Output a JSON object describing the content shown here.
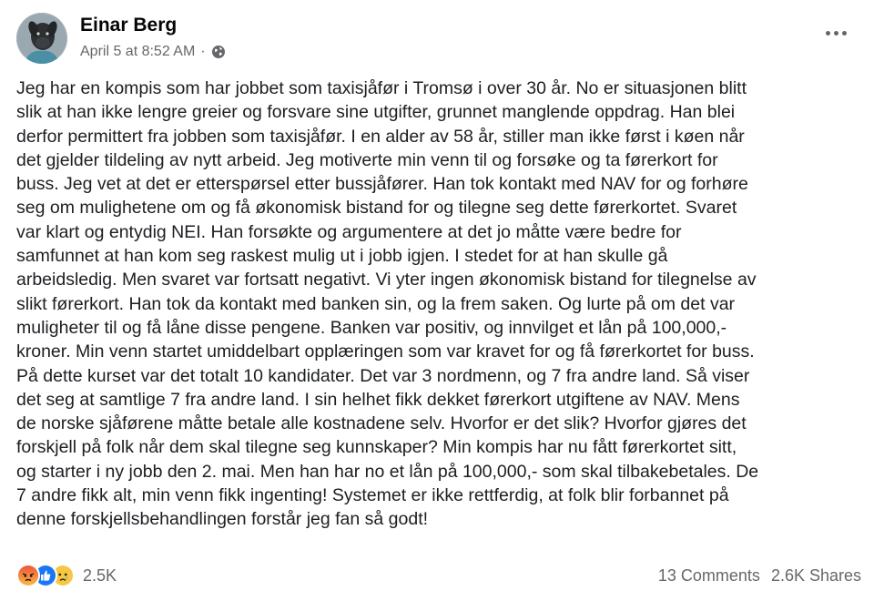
{
  "post": {
    "author": "Einar Berg",
    "timestamp": "April 5 at 8:52 AM",
    "separator": "·",
    "audience_icon": "globe-icon",
    "more_icon": "more-options-icon",
    "body_lines": [
      "Jeg har en kompis som har jobbet som taxisjåfør i Tromsø i over 30 år. No er situasjonen blitt",
      "slik at han ikke lengre greier og forsvare sine utgifter, grunnet manglende oppdrag. Han blei",
      "derfor permittert fra jobben som taxisjåfør. I en alder av 58 år, stiller man ikke først i køen når",
      "det gjelder tildeling av nytt arbeid. Jeg motiverte min venn til og forsøke og ta førerkort for",
      "buss. Jeg vet at det er etterspørsel etter bussjåfører. Han tok kontakt med NAV for og forhøre",
      "seg om mulighetene om og få økonomisk bistand for og tilegne seg dette førerkortet. Svaret",
      "var klart og entydig NEI. Han forsøkte og argumentere at det jo måtte være bedre for",
      "samfunnet at han kom seg raskest mulig ut i jobb igjen. I stedet for at han skulle gå",
      "arbeidsledig. Men svaret var fortsatt negativt. Vi yter ingen økonomisk bistand for tilegnelse av",
      "slikt førerkort. Han tok da kontakt med banken sin, og la frem saken. Og lurte på om det var",
      "muligheter til og få låne disse pengene. Banken var positiv, og innvilget et lån på 100,000,-",
      "kroner. Min venn startet umiddelbart opplæringen som var kravet for og få førerkortet for buss.",
      "På dette kurset var det totalt 10 kandidater. Det var 3 nordmenn, og 7 fra andre land. Så viser",
      "det seg at samtlige 7 fra andre land. I sin helhet fikk dekket førerkort utgiftene av NAV. Mens",
      "de norske sjåførene måtte betale alle kostnadene selv. Hvorfor er det slik? Hvorfor gjøres det",
      "forskjell på folk når dem skal tilegne seg kunnskaper? Min kompis har nu fått førerkortet sitt,",
      "og starter i ny jobb den 2. mai. Men han har no et lån på 100,000,- som skal tilbakebetales. De",
      "7 andre fikk alt, min venn fikk ingenting! Systemet er ikke rettferdig, at folk blir forbannet på",
      "denne forskjellsbehandlingen forstår jeg fan så godt!"
    ],
    "reactions": {
      "icons": [
        "angry-reaction-icon",
        "like-reaction-icon",
        "sad-reaction-icon"
      ],
      "count": "2.5K"
    },
    "comments": "13 Comments",
    "shares": "2.6K Shares"
  },
  "colors": {
    "text": "#1c1e21",
    "muted": "#65676b",
    "like_blue": "#1877f2",
    "angry_orange": "#f7712b",
    "sad_yellow": "#f7c744"
  }
}
